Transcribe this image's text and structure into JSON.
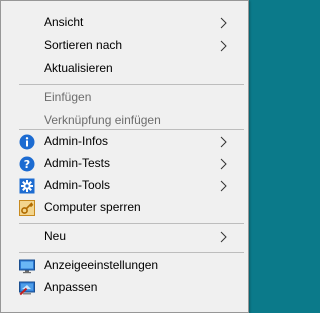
{
  "menu": {
    "items": [
      {
        "label": "Ansicht",
        "submenu": true
      },
      {
        "label": "Sortieren nach",
        "submenu": true
      },
      {
        "label": "Aktualisieren"
      },
      {
        "label": "Einfügen",
        "disabled": true
      },
      {
        "label": "Verknüpfung einfügen",
        "disabled": true
      },
      {
        "label": "Admin-Infos",
        "icon": "info-icon",
        "submenu": true
      },
      {
        "label": "Admin-Tests",
        "icon": "help-question-icon",
        "submenu": true
      },
      {
        "label": "Admin-Tools",
        "icon": "gear-icon",
        "submenu": true
      },
      {
        "label": "Computer sperren",
        "icon": "key-lock-icon"
      },
      {
        "label": "Neu",
        "submenu": true
      },
      {
        "label": "Anzeigeeinstellungen",
        "icon": "display-settings-icon"
      },
      {
        "label": "Anpassen",
        "icon": "personalize-icon"
      }
    ]
  },
  "colors": {
    "menu_bg": "#f0f0f0",
    "border": "#979797",
    "separator": "#bdbdbd",
    "disabled_text": "#6d6d6d",
    "icon_blue": "#1c6bd1",
    "key_orange": "#d99a2b",
    "desktop_bg": "#0b7a8a"
  }
}
